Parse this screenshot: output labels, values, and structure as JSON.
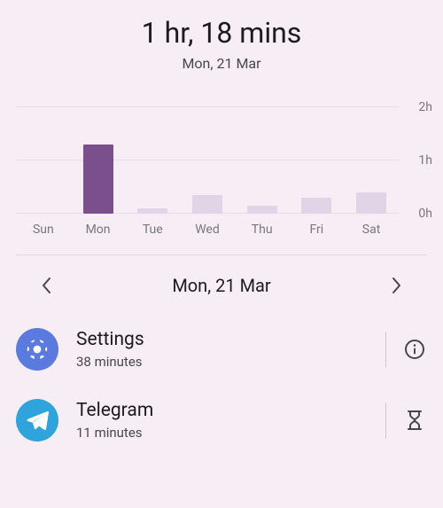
{
  "header": {
    "total": "1 hr, 18 mins",
    "date": "Mon, 21 Mar"
  },
  "chart_data": {
    "type": "bar",
    "categories": [
      "Sun",
      "Mon",
      "Tue",
      "Wed",
      "Thu",
      "Fri",
      "Sat"
    ],
    "values": [
      0,
      1.3,
      0.1,
      0.35,
      0.15,
      0.3,
      0.4
    ],
    "selected_index": 1,
    "ylabel": "",
    "xlabel": "",
    "ylim": [
      0,
      2
    ],
    "yticks": [
      0,
      1,
      2
    ],
    "ytick_labels": [
      "0h",
      "1h",
      "2h"
    ],
    "colors": {
      "bar": "#e2d4e7",
      "selected": "#7b4e8c"
    }
  },
  "nav": {
    "date": "Mon, 21 Mar"
  },
  "apps": [
    {
      "name": "Settings",
      "subtitle": "38 minutes",
      "icon": "settings-gear",
      "icon_bg": "#5b7ae0",
      "action": "info"
    },
    {
      "name": "Telegram",
      "subtitle": "11 minutes",
      "icon": "telegram",
      "icon_bg": "#2fa3db",
      "action": "hourglass"
    }
  ]
}
